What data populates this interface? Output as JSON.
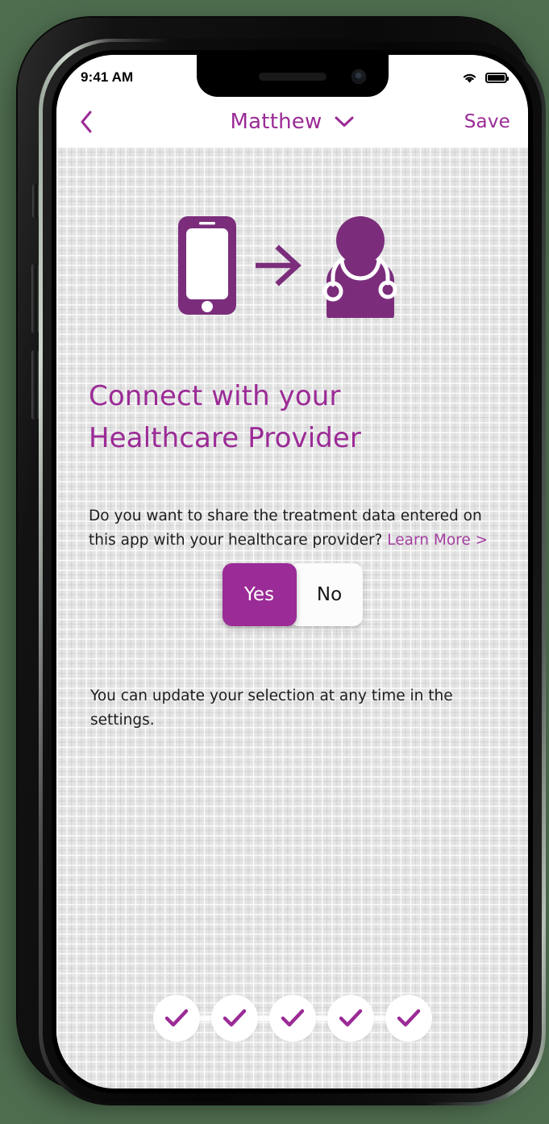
{
  "device": {
    "type": "smartphone-mockup",
    "outer_background_color": "#4e6d4f"
  },
  "status_bar": {
    "time": "9:41 AM",
    "wifi_icon": "wifi-icon",
    "battery_icon": "battery-full-icon",
    "battery_level_percent": 100
  },
  "nav_bar": {
    "back_icon": "chevron-left-icon",
    "title": "Matthew",
    "title_chevron_icon": "chevron-down-icon",
    "save_label": "Save",
    "accent_color": "#9b2b96",
    "background_color": "#ffffff"
  },
  "hero": {
    "phone_icon": "mobile-phone-icon",
    "arrow_icon": "arrow-right-icon",
    "doctor_icon": "doctor-with-stethoscope-icon",
    "icon_color": "#7b2d7b"
  },
  "main": {
    "headline_line1": "Connect with your",
    "headline_line2": "Healthcare Provider",
    "headline_color": "#9b2b96",
    "question_text": "Do you want to share the treatment data entered on this app with your healthcare provider?",
    "learn_more_label": "Learn More >",
    "learn_more_color": "#a23fa0",
    "footnote": "You can update your selection at any time in the settings."
  },
  "segmented_control": {
    "options": [
      {
        "label": "Yes",
        "selected": true
      },
      {
        "label": "No",
        "selected": false
      }
    ],
    "selected_value": "Yes",
    "selected_background": "#9b2b96",
    "unselected_background": "#fcfcfc"
  },
  "stepper": {
    "total_steps": 5,
    "completed_steps": 5,
    "check_icon": "check-icon",
    "check_color": "#9b2b96",
    "steps": [
      {
        "index": 1,
        "state": "complete"
      },
      {
        "index": 2,
        "state": "complete"
      },
      {
        "index": 3,
        "state": "complete"
      },
      {
        "index": 4,
        "state": "complete"
      },
      {
        "index": 5,
        "state": "complete"
      }
    ]
  },
  "background": {
    "content_background_color": "#e4e4e4",
    "pattern": "graph-paper-grid"
  }
}
